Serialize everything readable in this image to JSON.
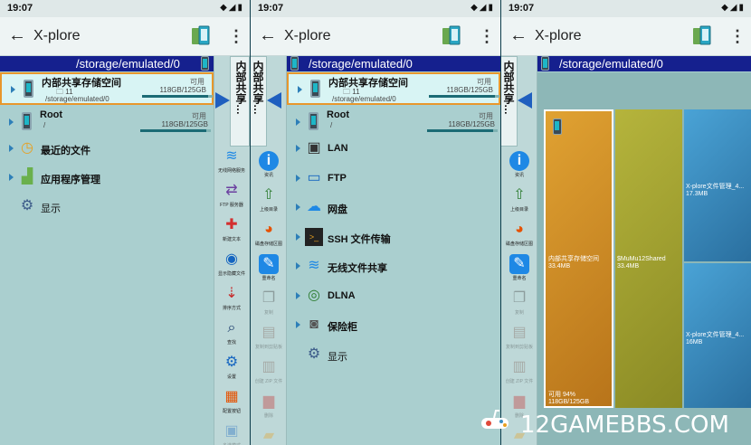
{
  "status": {
    "time": "19:07",
    "icons": "◆◢▮"
  },
  "app": {
    "title": "X-plore",
    "back_glyph": "←",
    "more_glyph": "⋮"
  },
  "path": "/storage/emulated/0",
  "panel1": {
    "rows": [
      {
        "name": "内部共享存储空间",
        "sub1": "🗀 11",
        "sub2": "/storage/emulated/0",
        "avail": "可用",
        "size": "118GB/125GB",
        "fill": 0.94
      },
      {
        "name": "Root",
        "sub1": "/",
        "avail": "可用",
        "size": "118GB/125GB",
        "fill": 0.94
      }
    ],
    "items": [
      {
        "label": "最近的文件",
        "icon": "clock-icon"
      },
      {
        "label": "应用程序管理",
        "icon": "android-icon"
      },
      {
        "label": "显示",
        "icon": "gears-icon"
      }
    ]
  },
  "panel2": {
    "rows": [
      {
        "name": "内部共享存储空间",
        "sub1": "🗀 11",
        "sub2": "/storage/emulated/0",
        "avail": "可用",
        "size": "118GB/125GB",
        "fill": 0.94
      },
      {
        "name": "Root",
        "sub1": "/",
        "avail": "可用",
        "size": "118GB/125GB",
        "fill": 0.94
      }
    ],
    "items": [
      {
        "label": "LAN",
        "icon": "lan-icon"
      },
      {
        "label": "FTP",
        "icon": "monitor-icon"
      },
      {
        "label": "网盘",
        "icon": "cloud-icon"
      },
      {
        "label": "SSH 文件传输",
        "icon": "terminal-icon"
      },
      {
        "label": "无线文件共享",
        "icon": "wifi-icon"
      },
      {
        "label": "DLNA",
        "icon": "dlna-icon"
      },
      {
        "label": "保险柜",
        "icon": "safe-icon"
      },
      {
        "label": "显示",
        "icon": "gears-icon"
      }
    ]
  },
  "side_tab": {
    "label": "内部共享…",
    "label_short": "内部共享"
  },
  "sidebar1": [
    {
      "label": "无线网络服务",
      "icon": "wifi-icon",
      "dim": false
    },
    {
      "label": "FTP 服务器",
      "icon": "ftp-server-icon",
      "dim": false
    },
    {
      "label": "新建文本",
      "icon": "new-text-icon",
      "dim": false
    },
    {
      "label": "显示隐藏文件",
      "icon": "eye-icon",
      "dim": false
    },
    {
      "label": "排序方式",
      "icon": "sort-icon",
      "dim": false
    },
    {
      "label": "查找",
      "icon": "search-icon",
      "dim": false
    },
    {
      "label": "设置",
      "icon": "gear-icon",
      "dim": false
    },
    {
      "label": "配置按钮",
      "icon": "config-buttons-icon",
      "dim": false
    },
    {
      "label": "多选模式",
      "icon": "multiselect-icon",
      "dim": true
    }
  ],
  "sidebar2": [
    {
      "label": "资讯",
      "icon": "info-icon",
      "dim": false
    },
    {
      "label": "上级目录",
      "icon": "up-arrow-icon",
      "dim": false
    },
    {
      "label": "磁盘存储区图",
      "icon": "pie-icon",
      "dim": false
    },
    {
      "label": "重命名",
      "icon": "rename-icon",
      "dim": false
    },
    {
      "label": "复制",
      "icon": "copy-icon",
      "dim": true
    },
    {
      "label": "复制到剪贴板",
      "icon": "clipboard-icon",
      "dim": true
    },
    {
      "label": "创建 ZIP 文件",
      "icon": "zip-icon",
      "dim": true
    },
    {
      "label": "删除",
      "icon": "trash-icon",
      "dim": true
    },
    {
      "label": "新建文件夹",
      "icon": "folder-icon",
      "dim": true
    }
  ],
  "treemap": [
    {
      "name": "内部共享存储空间",
      "size": "33.4MB",
      "extra1": "可用 94%",
      "extra2": "118GB/125GB",
      "color": "#d99a28"
    },
    {
      "name": "$MuMu12Shared",
      "size": "33.4MB",
      "color": "#a8a832"
    },
    {
      "name": "X-plore文件管理_4...",
      "size": "17.3MB",
      "color": "#3a8fc4"
    },
    {
      "name": "X-plore文件管理_4...",
      "size": "16MB",
      "color": "#3a8fc4"
    }
  ],
  "watermark": "12GAMEBBS.COM",
  "colors": {
    "pathbar": "#15208e",
    "accent": "#2d7fb8",
    "selected_border": "#e8972c",
    "bg": "#aacfcf"
  }
}
